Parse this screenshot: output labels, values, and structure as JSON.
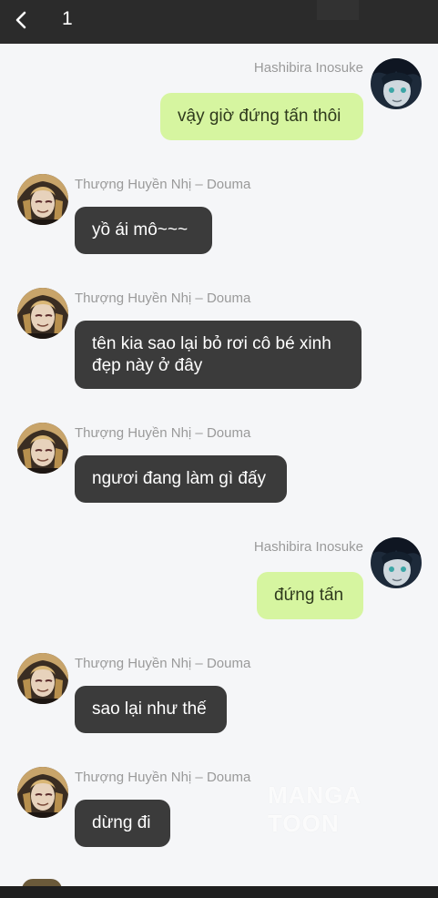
{
  "header": {
    "count": "1",
    "back_icon": "chevron-left-icon"
  },
  "messages": [
    {
      "sender": "Hashibira Inosuke",
      "text": "vậy giờ đứng tấn thôi",
      "side": "right"
    },
    {
      "sender": "Thượng Huyền Nhị – Douma",
      "text": "yồ ái mô~~~",
      "side": "left"
    },
    {
      "sender": "Thượng Huyền Nhị – Douma",
      "text": "tên kia sao lại bỏ rơi cô bé xinh đẹp này ở đây",
      "side": "left"
    },
    {
      "sender": "Thượng Huyền Nhị – Douma",
      "text": "ngươi đang làm gì đấy",
      "side": "left"
    },
    {
      "sender": "Hashibira Inosuke",
      "text": "đứng tấn",
      "side": "right"
    },
    {
      "sender": "Thượng Huyền Nhị – Douma",
      "text": "sao lại như thế",
      "side": "left"
    },
    {
      "sender": "Thượng Huyền Nhị – Douma",
      "text": "dừng đi",
      "side": "left"
    }
  ],
  "watermark": "MANGA TOON",
  "colors": {
    "topbar": "#2b2b2b",
    "background": "#f5f6f8",
    "my_bubble": "#d6f5a0",
    "their_bubble": "#3b3b3b"
  }
}
